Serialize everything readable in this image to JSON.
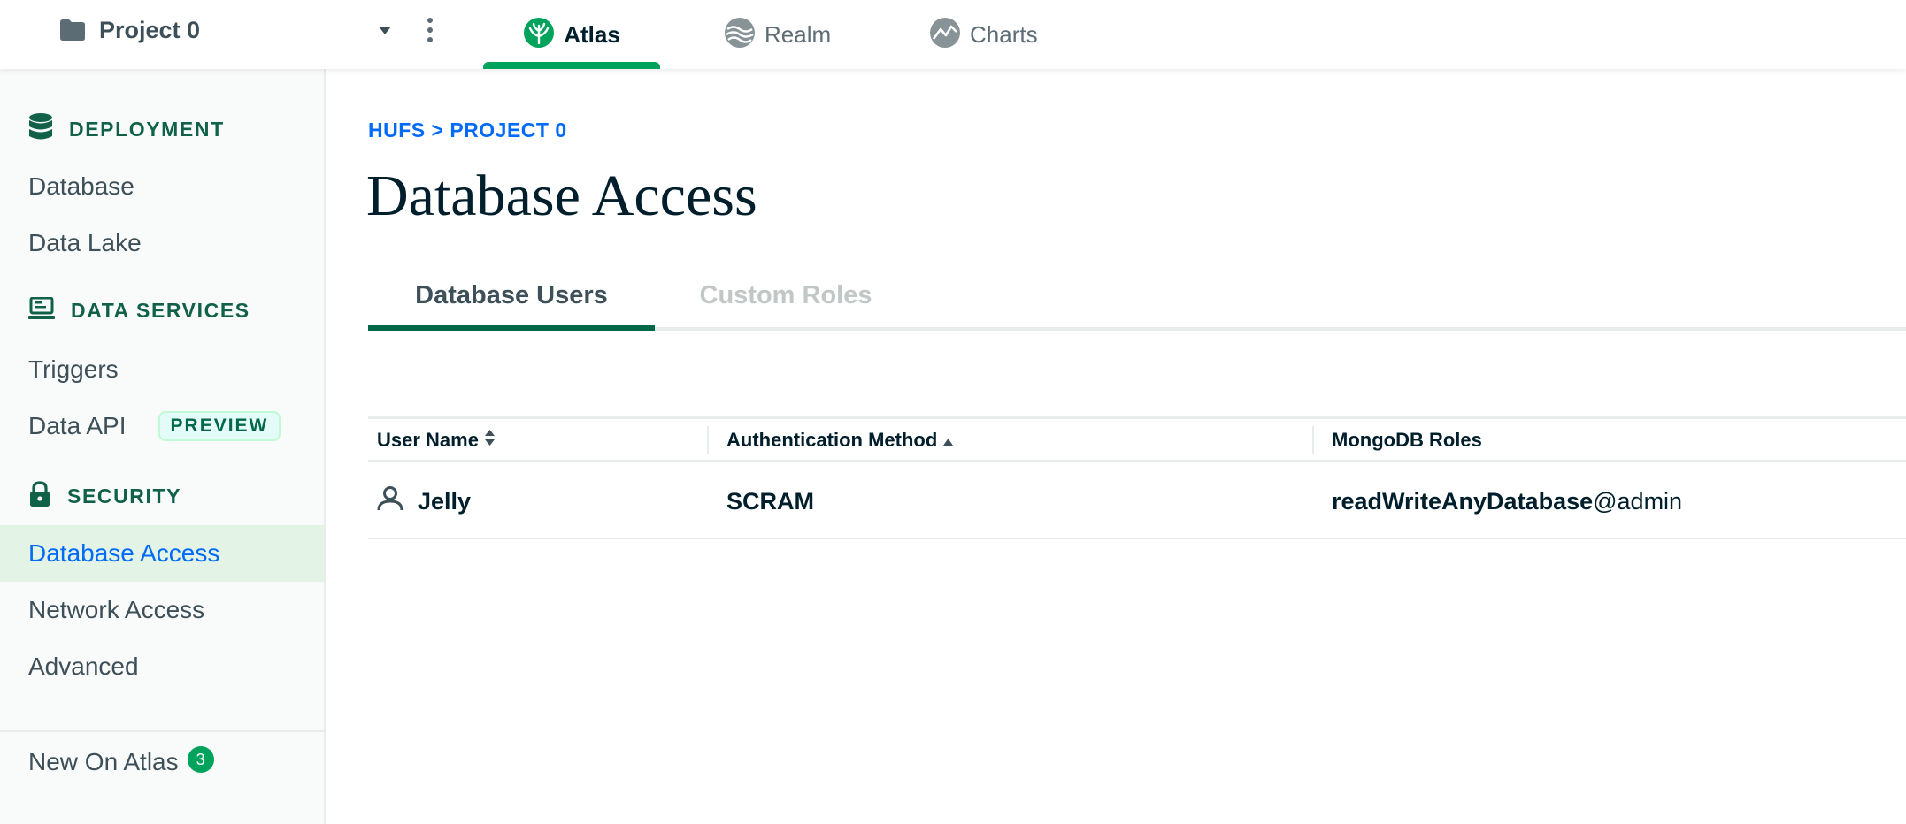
{
  "topbar": {
    "project_name": "Project 0",
    "products": {
      "atlas": "Atlas",
      "realm": "Realm",
      "charts": "Charts"
    },
    "icons": {
      "project": "folder-icon",
      "caret": "caret-down-icon",
      "menu": "kebab-menu-icon",
      "atlas": "atlas-leaf-icon",
      "realm": "realm-icon",
      "charts": "charts-icon"
    }
  },
  "sidebar": {
    "sections": [
      {
        "heading": "DEPLOYMENT",
        "icon": "database-icon",
        "items": [
          {
            "label": "Database"
          },
          {
            "label": "Data Lake"
          }
        ]
      },
      {
        "heading": "DATA SERVICES",
        "icon": "laptop-icon",
        "items": [
          {
            "label": "Triggers"
          },
          {
            "label": "Data API",
            "badge": "PREVIEW"
          }
        ]
      },
      {
        "heading": "SECURITY",
        "icon": "lock-icon",
        "items": [
          {
            "label": "Database Access",
            "active": true
          },
          {
            "label": "Network Access"
          },
          {
            "label": "Advanced"
          }
        ]
      }
    ],
    "footer": {
      "label": "New On Atlas",
      "count": "3"
    }
  },
  "main": {
    "breadcrumb": "HUFS > PROJECT 0",
    "title": "Database Access",
    "tabs": [
      {
        "label": "Database Users",
        "active": true
      },
      {
        "label": "Custom Roles",
        "active": false
      }
    ],
    "table": {
      "columns": [
        {
          "label": "User Name",
          "sort_icon": "sort-both-icon"
        },
        {
          "label": "Authentication Method",
          "sort_icon": "sort-ascending-icon"
        },
        {
          "label": "MongoDB Roles"
        }
      ],
      "rows": [
        {
          "user": "Jelly",
          "user_icon": "person-icon",
          "auth_method": "SCRAM",
          "role_name": "readWriteAnyDatabase",
          "role_db": "@admin"
        }
      ]
    }
  },
  "colors": {
    "accent_green": "#00a35c",
    "section_green": "#116149",
    "link_blue": "#016bf8",
    "active_item_bg": "#e3f4e6"
  }
}
